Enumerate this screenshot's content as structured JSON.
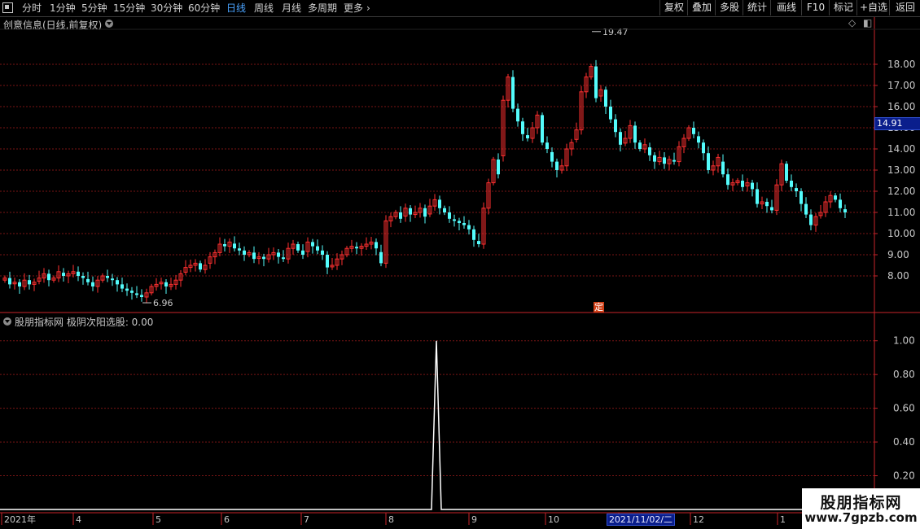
{
  "toolbar": {
    "periods": [
      "分时",
      "1分钟",
      "5分钟",
      "15分钟",
      "30分钟",
      "60分钟",
      "日线",
      "周线",
      "月线",
      "多周期",
      "更多"
    ],
    "active_period": "日线",
    "buttons": [
      "复权",
      "叠加",
      "多股",
      "统计",
      "画线",
      "F10",
      "标记",
      "+自选",
      "返回"
    ]
  },
  "main_panel": {
    "title": "创意信息(日线,前复权)"
  },
  "indicator_panel": {
    "title": "股朋指标网 极阴次阳选股: 0.00"
  },
  "tags": {
    "settle_marker": "定",
    "current_price": "14.91",
    "date_marker": "2021/11/02/二"
  },
  "watermark": {
    "name": "股朋指标网",
    "url": "www.7gpzb.com"
  },
  "colors": {
    "up": "#ff3030",
    "down": "#54fcfc",
    "grid": "#7a1515",
    "axis": "#c8242a",
    "signal": "#ffffff"
  },
  "chart_data": [
    {
      "type": "candlestick",
      "title": "创意信息(日线,前复权)",
      "ylim": [
        7.0,
        20.0
      ],
      "y_ticks": [
        "8.00",
        "9.00",
        "10.00",
        "11.00",
        "12.00",
        "13.00",
        "14.00",
        "15.00",
        "16.00",
        "17.00",
        "18.00"
      ],
      "x_ticks": [
        "2021年",
        "4",
        "5",
        "6",
        "7",
        "8",
        "9",
        "10",
        "11",
        "12",
        "1"
      ],
      "annotations": [
        {
          "label": "19.47",
          "value": 19.47
        },
        {
          "label": "6.96",
          "value": 6.96
        }
      ],
      "closes": [
        7.9,
        7.6,
        7.7,
        7.5,
        7.8,
        7.6,
        7.7,
        7.9,
        8.1,
        7.8,
        7.9,
        8.2,
        8.0,
        8.1,
        8.2,
        8.0,
        7.9,
        7.7,
        7.5,
        7.8,
        8.0,
        7.9,
        7.8,
        7.6,
        7.4,
        7.3,
        7.2,
        7.1,
        7.0,
        7.2,
        7.5,
        7.6,
        7.7,
        7.5,
        7.6,
        7.8,
        8.1,
        8.4,
        8.5,
        8.6,
        8.3,
        8.5,
        8.9,
        9.1,
        9.5,
        9.4,
        9.6,
        9.3,
        9.2,
        9.0,
        9.1,
        8.8,
        8.9,
        8.8,
        9.0,
        9.1,
        8.9,
        8.8,
        9.3,
        9.5,
        9.2,
        9.0,
        9.6,
        9.4,
        9.2,
        9.0,
        8.4,
        8.5,
        8.8,
        9.0,
        9.3,
        9.4,
        9.3,
        9.4,
        9.5,
        9.6,
        9.3,
        8.6,
        10.6,
        10.8,
        11.0,
        10.7,
        11.2,
        10.9,
        11.0,
        11.2,
        10.8,
        11.3,
        11.6,
        11.2,
        11.0,
        10.7,
        10.6,
        10.5,
        10.4,
        10.2,
        9.7,
        9.5,
        11.2,
        12.4,
        13.5,
        12.8,
        16.3,
        17.4,
        15.9,
        15.3,
        14.7,
        14.5,
        15.0,
        15.6,
        14.3,
        14.0,
        13.4,
        13.0,
        13.2,
        14.0,
        14.3,
        14.9,
        16.7,
        17.4,
        17.9,
        16.4,
        16.8,
        16.0,
        15.4,
        14.8,
        14.2,
        14.5,
        15.1,
        14.3,
        14.0,
        14.2,
        13.7,
        13.4,
        13.6,
        13.3,
        13.5,
        13.4,
        14.1,
        14.5,
        15.0,
        14.7,
        14.3,
        13.8,
        13.0,
        13.2,
        13.6,
        12.8,
        12.3,
        12.4,
        12.5,
        12.2,
        12.4,
        12.1,
        11.4,
        11.5,
        11.3,
        11.1,
        12.3,
        13.3,
        12.5,
        12.2,
        12.0,
        11.4,
        10.9,
        10.4,
        10.8,
        11.0,
        11.5,
        11.8,
        11.6,
        11.2,
        11.0
      ]
    },
    {
      "type": "line",
      "title": "股朋指标网 极阴次阳选股: 0.00",
      "ylim": [
        0,
        1.1
      ],
      "y_ticks": [
        "0.20",
        "0.40",
        "0.60",
        "0.80",
        "1.00"
      ],
      "signal_value": 1.0,
      "baseline_value": 0.0,
      "signal_bar_index": 77
    }
  ]
}
